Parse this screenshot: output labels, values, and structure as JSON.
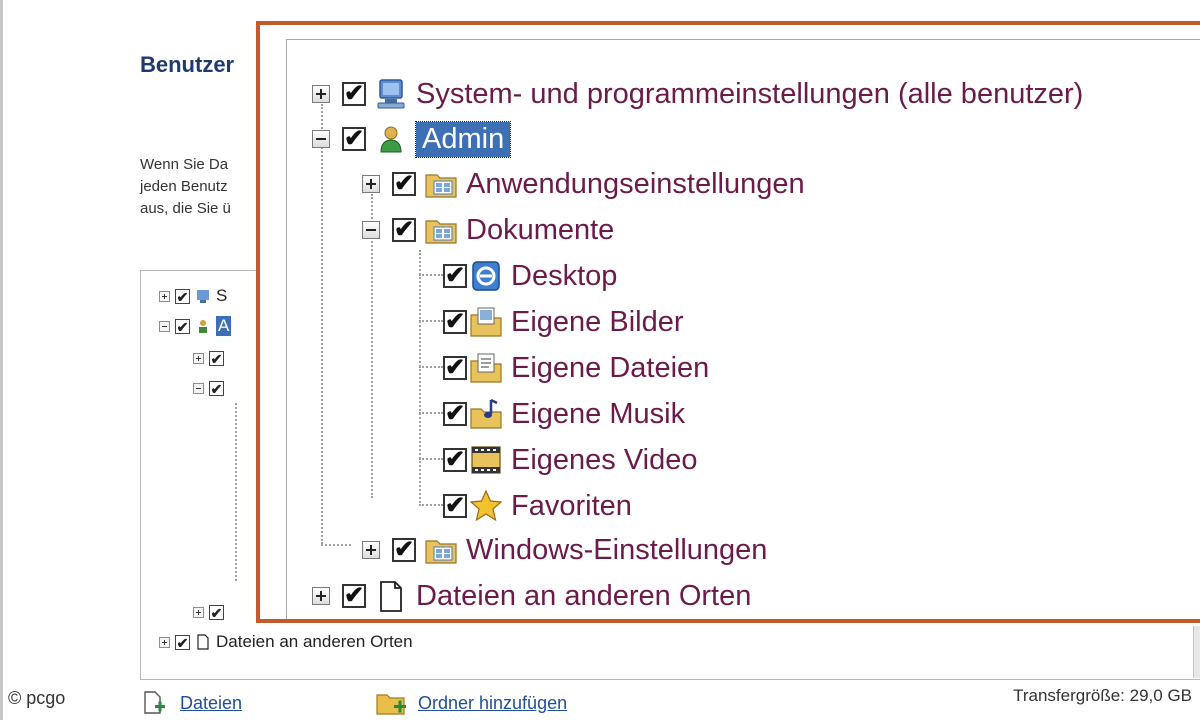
{
  "background": {
    "title": "Benutzer",
    "description": "Wenn Sie Da\njeden Benutz\naus, die Sie ü",
    "tree_rows": [
      {
        "label": "S",
        "expander": "plus"
      },
      {
        "label": "A",
        "expander": "minus"
      },
      {
        "label": "",
        "expander": "plus"
      },
      {
        "label": "",
        "expander": "minus"
      },
      {
        "label": "",
        "expander": "plus"
      },
      {
        "label": "Dateien an anderen Orten",
        "expander": "plus"
      }
    ]
  },
  "watermark": "© pcgo",
  "bottom_bar": {
    "files_label": "Dateien",
    "add_folder_label": "Ordner hinzufügen",
    "transfer_size": "Transfergröße: 29,0 GB"
  },
  "tree": {
    "items": [
      {
        "label": "System- und programmeinstellungen (alle benutzer)",
        "icon": "system-settings-icon",
        "expander": "plus",
        "checked": true
      },
      {
        "label": "Admin",
        "icon": "user-icon",
        "expander": "minus",
        "checked": true,
        "selected": true
      },
      {
        "label": "Anwendungseinstellungen",
        "icon": "folder-icon",
        "expander": "plus",
        "checked": true
      },
      {
        "label": "Dokumente",
        "icon": "folder-icon",
        "expander": "minus",
        "checked": true
      },
      {
        "label": "Desktop",
        "icon": "desktop-icon",
        "checked": true
      },
      {
        "label": "Eigene Bilder",
        "icon": "pictures-icon",
        "checked": true
      },
      {
        "label": "Eigene Dateien",
        "icon": "documents-icon",
        "checked": true
      },
      {
        "label": "Eigene Musik",
        "icon": "music-icon",
        "checked": true
      },
      {
        "label": "Eigenes Video",
        "icon": "video-icon",
        "checked": true
      },
      {
        "label": "Favoriten",
        "icon": "favorites-star-icon",
        "checked": true
      },
      {
        "label": "Windows-Einstellungen",
        "icon": "folder-icon",
        "expander": "plus",
        "checked": true
      },
      {
        "label": "Dateien an anderen Orten",
        "icon": "file-icon",
        "expander": "plus",
        "checked": true
      }
    ]
  },
  "checkmark": "✔",
  "colors": {
    "accent_border": "#c45a2c",
    "selection": "#3d6fb5",
    "label_text": "#6b1a4a"
  }
}
